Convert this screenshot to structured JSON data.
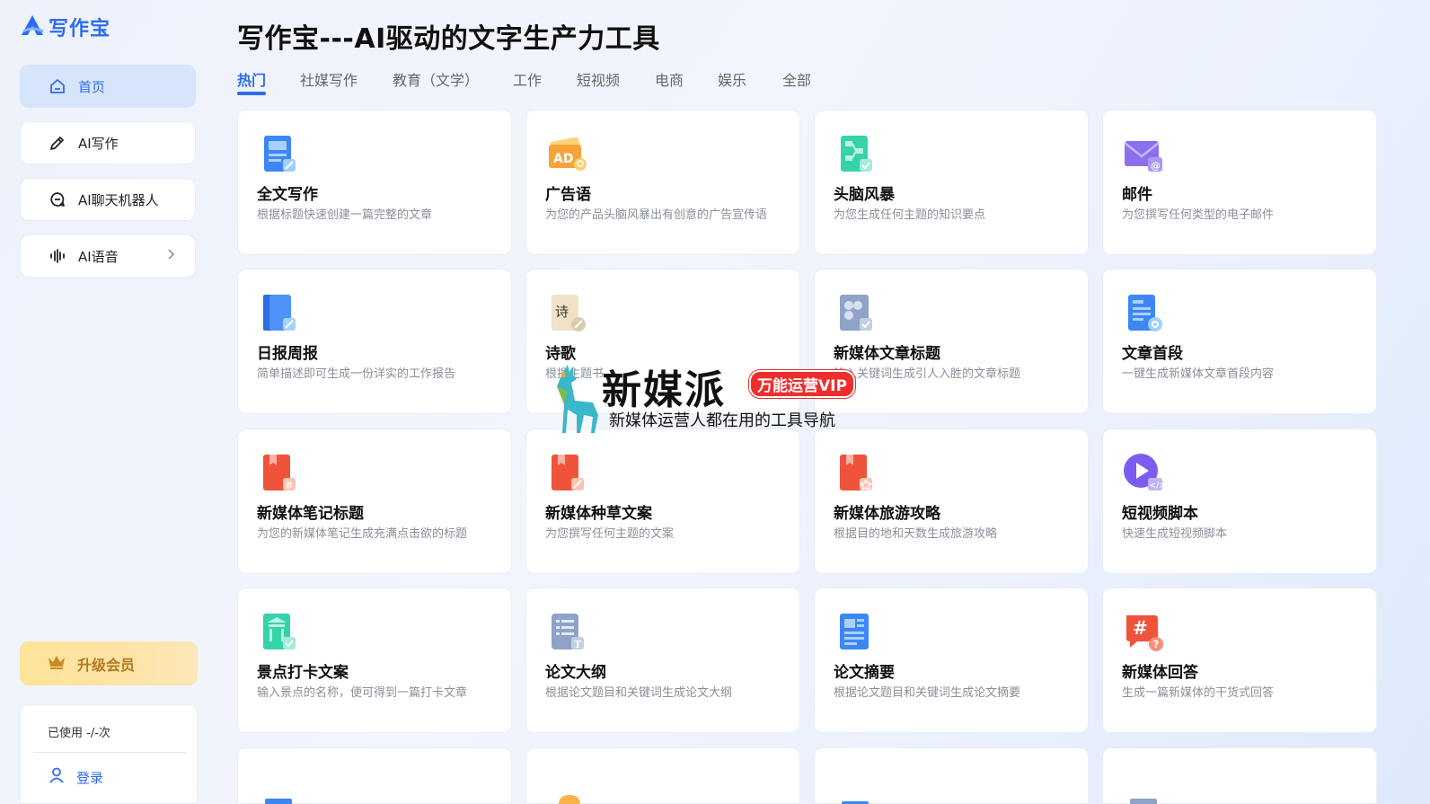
{
  "app": {
    "brand": "写作宝"
  },
  "sidebar": {
    "items": [
      {
        "label": "首页",
        "icon": "home-icon",
        "active": true
      },
      {
        "label": "AI写作",
        "icon": "pen-icon"
      },
      {
        "label": "AI聊天机器人",
        "icon": "chat-bot-icon"
      },
      {
        "label": "AI语音",
        "icon": "soundwave-icon",
        "has_submenu": true
      }
    ],
    "upgrade_label": "升级会员",
    "usage_text": "已使用 -/-次",
    "login_label": "登录"
  },
  "main": {
    "title": "写作宝---AI驱动的文字生产力工具",
    "tabs": [
      {
        "label": "热门",
        "active": true
      },
      {
        "label": "社媒写作"
      },
      {
        "label": "教育（文学）"
      },
      {
        "label": "工作"
      },
      {
        "label": "短视频"
      },
      {
        "label": "电商"
      },
      {
        "label": "娱乐"
      },
      {
        "label": "全部"
      }
    ],
    "cards": [
      {
        "title": "全文写作",
        "desc": "根据标题快速创建一篇完整的文章",
        "icon": "document-edit-icon"
      },
      {
        "title": "广告语",
        "desc": "为您的产品头脑风暴出有创意的广告宣传语",
        "icon": "ad-icon"
      },
      {
        "title": "头脑风暴",
        "desc": "为您生成任何主题的知识要点",
        "icon": "mindmap-icon"
      },
      {
        "title": "邮件",
        "desc": "为您撰写任何类型的电子邮件",
        "icon": "email-icon"
      },
      {
        "title": "日报周报",
        "desc": "简单描述即可生成一份详实的工作报告",
        "icon": "report-book-icon"
      },
      {
        "title": "诗歌",
        "desc": "根据主题书",
        "icon": "poem-scroll-icon"
      },
      {
        "title": "新媒体文章标题",
        "desc": "输入关键词生成引人入胜的文章标题",
        "icon": "headline-icon"
      },
      {
        "title": "文章首段",
        "desc": "一键生成新媒体文章首段内容",
        "icon": "paragraph-settings-icon"
      },
      {
        "title": "新媒体笔记标题",
        "desc": "为您的新媒体笔记生成充满点击欲的标题",
        "icon": "hashtag-note-icon"
      },
      {
        "title": "新媒体种草文案",
        "desc": "为您撰写任何主题的文案",
        "icon": "note-edit-icon"
      },
      {
        "title": "新媒体旅游攻略",
        "desc": "根据目的地和天数生成旅游攻略",
        "icon": "travel-star-icon"
      },
      {
        "title": "短视频脚本",
        "desc": "快速生成短视频脚本",
        "icon": "video-play-icon"
      },
      {
        "title": "景点打卡文案",
        "desc": "输入景点的名称，便可得到一篇打卡文章",
        "icon": "landmark-checkin-icon"
      },
      {
        "title": "论文大纲",
        "desc": "根据论文题目和关键词生成论文大纲",
        "icon": "outline-doc-icon"
      },
      {
        "title": "论文摘要",
        "desc": "根据论文题目和关键词生成论文摘要",
        "icon": "abstract-doc-icon"
      },
      {
        "title": "新媒体回答",
        "desc": "生成一篇新媒体的干货式回答",
        "icon": "qa-hashtag-icon"
      }
    ]
  },
  "watermark": {
    "title": "新媒派",
    "badge": "万能运营VIP",
    "subtitle": "新媒体运营人都在用的工具导航"
  },
  "colors": {
    "accent": "#2f6bf2",
    "upgrade_text": "#b47a22",
    "watermark_badge": "#ef2d2d"
  }
}
